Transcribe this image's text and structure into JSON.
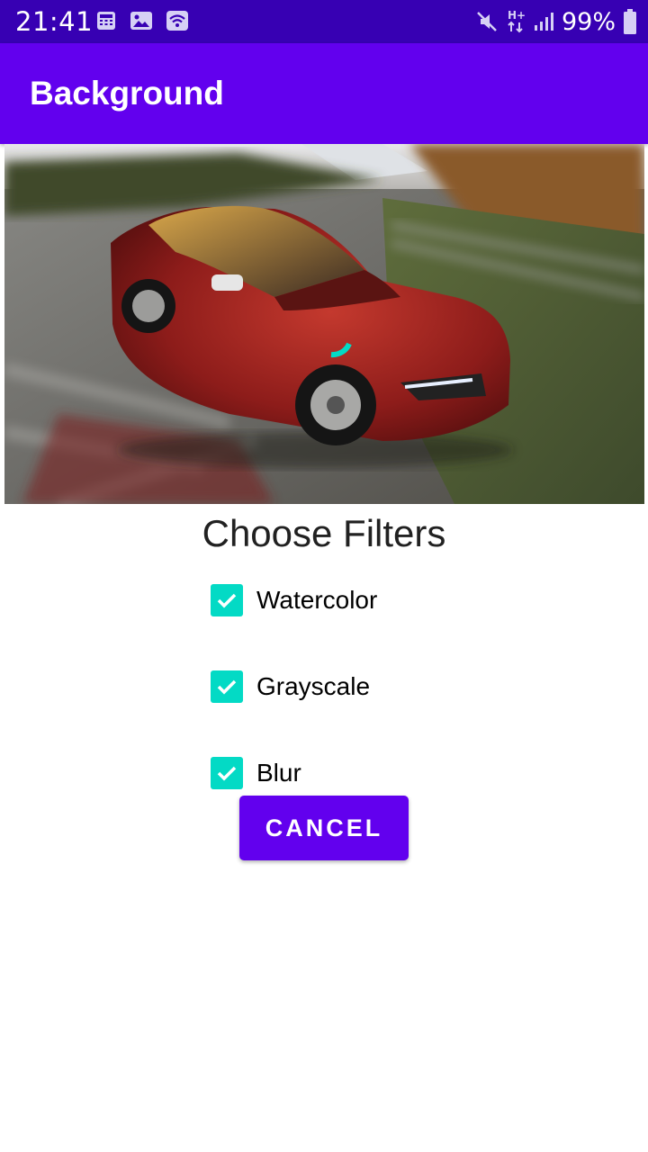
{
  "status_bar": {
    "time": "21:41",
    "battery_percent": "99%",
    "left_icons": [
      "calculator-icon",
      "image-icon",
      "wifi-icon"
    ],
    "right_icons": [
      "mute-icon",
      "hplus-data-icon",
      "signal-icon",
      "battery-icon"
    ]
  },
  "app_bar": {
    "title": "Background",
    "color": "#6200ee"
  },
  "photo": {
    "subject": "red car on a race track with motion blur"
  },
  "filters": {
    "heading": "Choose Filters",
    "items": [
      {
        "label": "Watercolor",
        "checked": true
      },
      {
        "label": "Grayscale",
        "checked": true
      },
      {
        "label": "Blur",
        "checked": true
      }
    ],
    "checkbox_color": "#03dac5"
  },
  "actions": {
    "cancel_label": "CANCEL"
  },
  "colors": {
    "status_bar": "#3700b3",
    "primary": "#6200ee",
    "accent": "#03dac5"
  }
}
